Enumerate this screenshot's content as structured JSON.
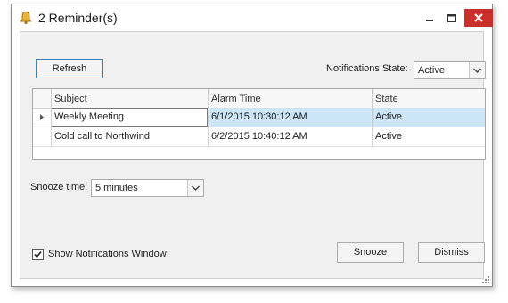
{
  "window": {
    "title": "2 Reminder(s)",
    "close_color": "#c9302c",
    "icons": {
      "app": "bell-icon",
      "minimize": "minimize-icon",
      "maximize": "maximize-icon",
      "close": "close-icon"
    }
  },
  "toolbar": {
    "refresh_label": "Refresh",
    "notifications_state_label": "Notifications State:",
    "notifications_state_value": "Active"
  },
  "grid": {
    "columns": [
      "Subject",
      "Alarm Time",
      "State"
    ],
    "rows": [
      {
        "subject": "Weekly Meeting",
        "alarm_time": "6/1/2015 10:30:12 AM",
        "state": "Active",
        "selected": true
      },
      {
        "subject": "Cold call to Northwind",
        "alarm_time": "6/2/2015 10:40:12 AM",
        "state": "Active",
        "selected": false
      }
    ],
    "selection_color": "#cde6f7"
  },
  "snooze": {
    "label": "Snooze time:",
    "value": "5 minutes"
  },
  "footer": {
    "show_window_label": "Show Notifications Window",
    "show_window_checked": true,
    "snooze_label": "Snooze",
    "dismiss_label": "Dismiss"
  }
}
